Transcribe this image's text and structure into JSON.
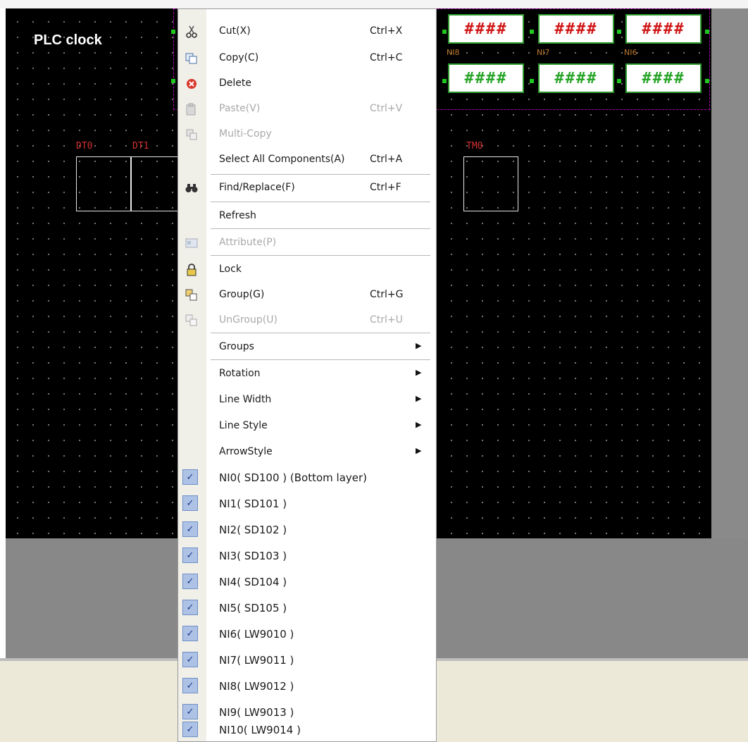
{
  "page": {
    "title": "PLC clock"
  },
  "fields": [
    {
      "label": "DT0"
    },
    {
      "label": "DT1"
    },
    {
      "label": "TM0"
    }
  ],
  "numeric_boxes": {
    "row1_text": "####",
    "row2_text": "####",
    "tags": [
      "NI8",
      "NI7",
      "NI6"
    ]
  },
  "context_menu": {
    "cut": {
      "label": "Cut(X)",
      "shortcut": "Ctrl+X"
    },
    "copy": {
      "label": "Copy(C)",
      "shortcut": "Ctrl+C"
    },
    "delete": {
      "label": "Delete"
    },
    "paste": {
      "label": "Paste(V)",
      "shortcut": "Ctrl+V"
    },
    "multicopy": {
      "label": "Multi-Copy"
    },
    "select_all": {
      "label": "Select All Components(A)",
      "shortcut": "Ctrl+A"
    },
    "find": {
      "label": "Find/Replace(F)",
      "shortcut": "Ctrl+F"
    },
    "refresh": {
      "label": "Refresh"
    },
    "attribute": {
      "label": "Attribute(P)"
    },
    "lock": {
      "label": "Lock"
    },
    "group": {
      "label": "Group(G)",
      "shortcut": "Ctrl+G"
    },
    "ungroup": {
      "label": "UnGroup(U)",
      "shortcut": "Ctrl+U"
    },
    "groups": {
      "label": "Groups"
    },
    "rotation": {
      "label": "Rotation"
    },
    "line_width": {
      "label": "Line Width"
    },
    "line_style": {
      "label": "Line Style"
    },
    "arrow_style": {
      "label": "ArrowStyle"
    },
    "layers": [
      "NI0( SD100 ) (Bottom layer)",
      "NI1( SD101 )",
      "NI2( SD102 )",
      "NI3( SD103 )",
      "NI4( SD104 )",
      "NI5( SD105 )",
      "NI6( LW9010 )",
      "NI7( LW9011 )",
      "NI8( LW9012 )",
      "NI9( LW9013 )",
      "NI10( LW9014 )"
    ]
  }
}
